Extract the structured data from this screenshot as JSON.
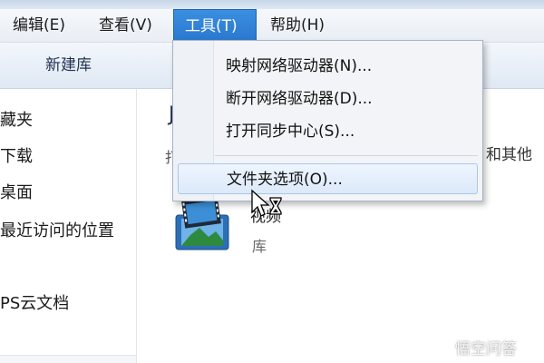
{
  "menubar": {
    "items": [
      {
        "label": "编辑(E)"
      },
      {
        "label": "查看(V)"
      },
      {
        "label": "工具(T)"
      },
      {
        "label": "帮助(H)"
      }
    ]
  },
  "toolbar": {
    "new_library_label": "新建库"
  },
  "nav": {
    "items": [
      {
        "label": "藏夹"
      },
      {
        "label": "下载"
      },
      {
        "label": "桌面"
      },
      {
        "label": "最近访问的位置"
      },
      {
        "label": "PS云文档"
      }
    ]
  },
  "main": {
    "heading_partial": "J",
    "subtext_left": "打",
    "subtext": "和其他",
    "library": {
      "name": "视频",
      "type": "库"
    }
  },
  "tools_menu": {
    "items": [
      {
        "label": "映射网络驱动器(N)..."
      },
      {
        "label": "断开网络驱动器(D)..."
      },
      {
        "label": "打开同步中心(S)..."
      },
      {
        "label": "文件夹选项(O)..."
      }
    ]
  },
  "watermark": {
    "text": "悟空问答"
  },
  "colors": {
    "menu_active": "#2a78cf",
    "menu_hover": "#dce9f9"
  }
}
